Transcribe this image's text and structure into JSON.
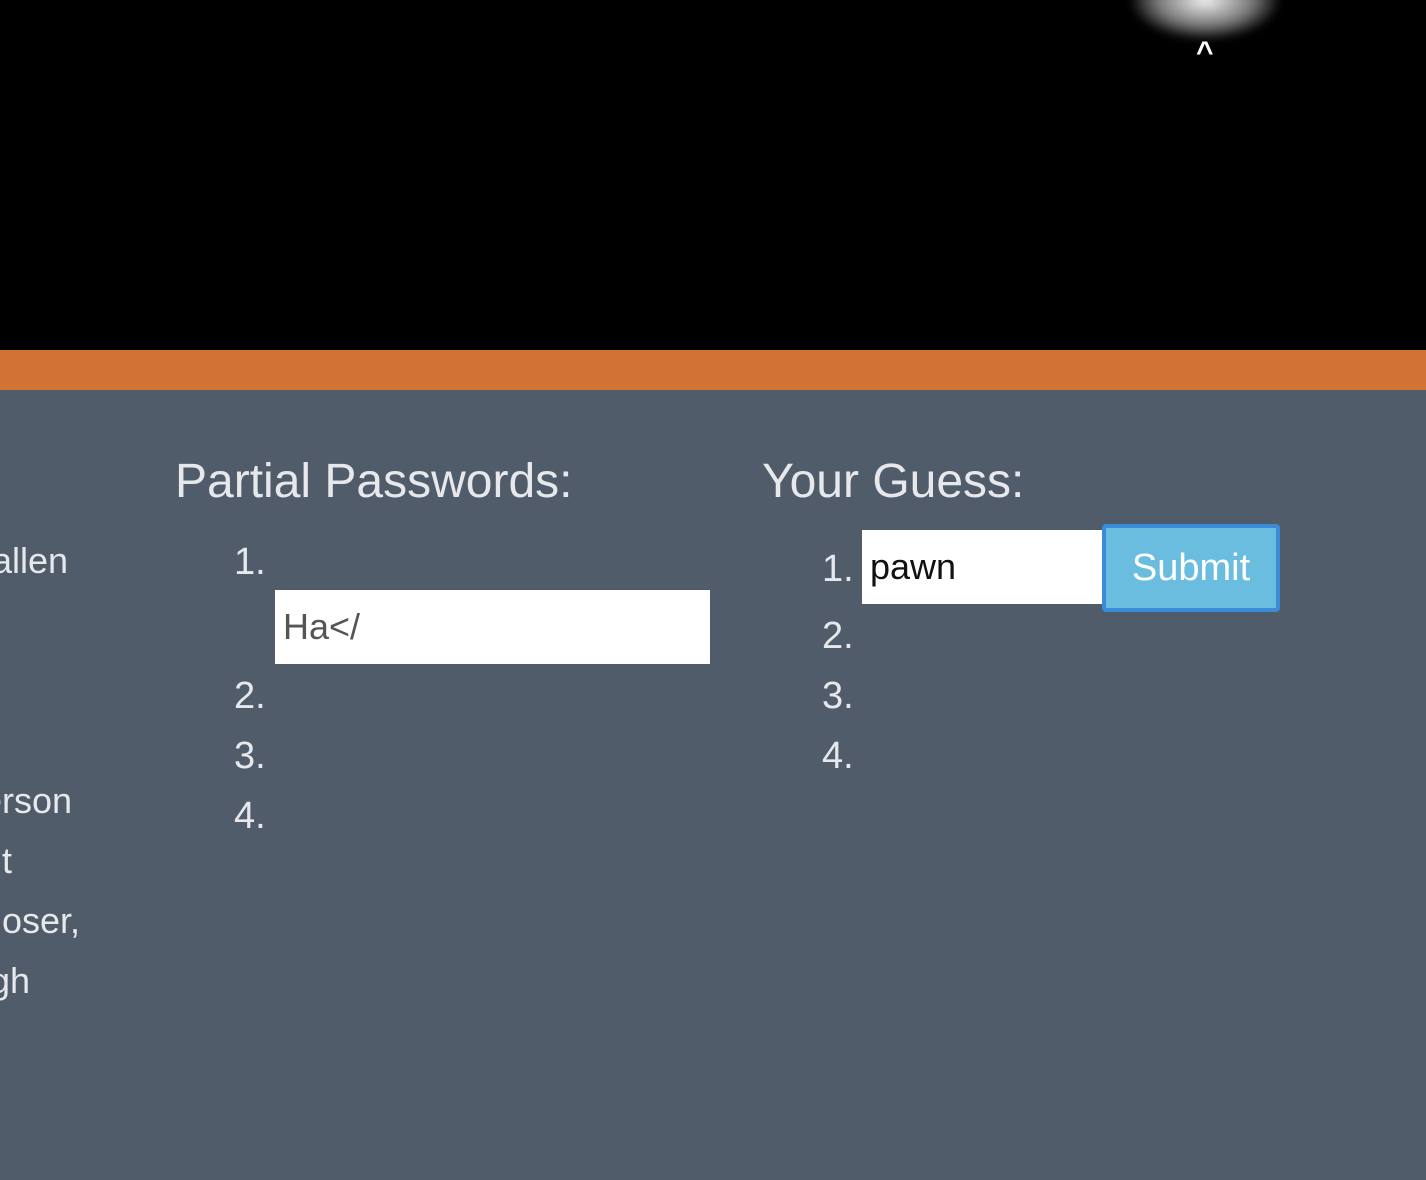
{
  "header": {
    "caret_glyph": "^"
  },
  "left_column": {
    "clipped_lines": [
      "allen",
      "erson",
      "nt",
      "loser,",
      "gh"
    ]
  },
  "partial_passwords": {
    "title": "Partial Passwords:",
    "items": [
      {
        "number": "1.",
        "value": "Ha</"
      },
      {
        "number": "2.",
        "value": ""
      },
      {
        "number": "3.",
        "value": ""
      },
      {
        "number": "4.",
        "value": ""
      }
    ]
  },
  "your_guess": {
    "title": "Your Guess:",
    "items": [
      {
        "number": "1.",
        "input_value": "pawn"
      },
      {
        "number": "2."
      },
      {
        "number": "3."
      },
      {
        "number": "4."
      }
    ],
    "submit_label": "Submit"
  },
  "colors": {
    "background": "#515c6b",
    "top_area": "#000000",
    "accent_bar": "#d27234",
    "submit_fill": "#6bbde0",
    "submit_border": "#3a8bd8"
  }
}
